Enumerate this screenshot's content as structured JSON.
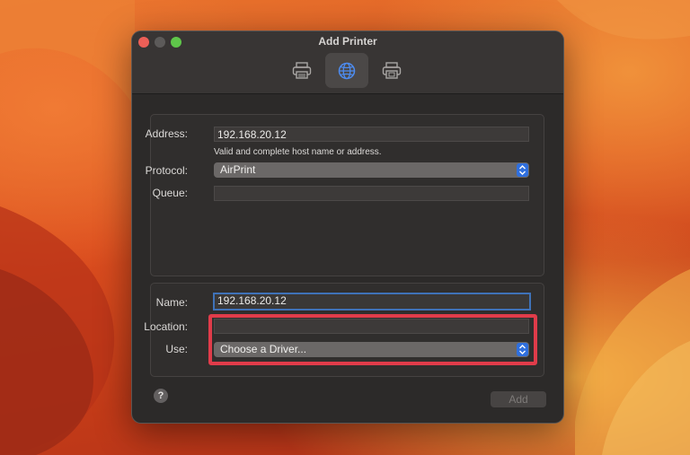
{
  "window": {
    "title": "Add Printer"
  },
  "toolbar": {
    "items": [
      {
        "name": "Default",
        "icon": "printer-icon",
        "active": false
      },
      {
        "name": "IP",
        "icon": "globe-icon",
        "active": true
      },
      {
        "name": "Windows",
        "icon": "windows-printer-icon",
        "active": false
      }
    ]
  },
  "ip_form": {
    "address_label": "Address:",
    "address_value": "192.168.20.12",
    "address_hint": "Valid and complete host name or address.",
    "protocol_label": "Protocol:",
    "protocol_value": "AirPrint",
    "queue_label": "Queue:",
    "queue_value": ""
  },
  "printer_info": {
    "name_label": "Name:",
    "name_value": "192.168.20.12",
    "location_label": "Location:",
    "location_value": "",
    "use_label": "Use:",
    "use_value": "Choose a Driver..."
  },
  "footer": {
    "help_label": "?",
    "add_label": "Add"
  },
  "colors": {
    "accent": "#2f6fde",
    "highlight": "#e03c4a",
    "focus_ring": "#3f72b8"
  }
}
